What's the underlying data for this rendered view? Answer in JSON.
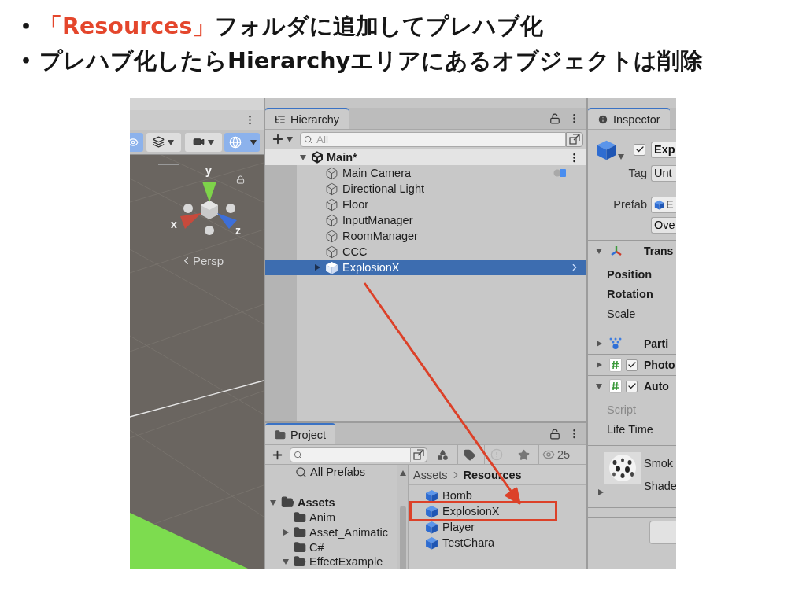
{
  "slide": {
    "bullets": [
      {
        "marker": "•",
        "segments": [
          {
            "text": "「Resources」",
            "emphasis": true
          },
          {
            "text": "フォルダに追加してプレハブ化",
            "emphasis": false
          }
        ]
      },
      {
        "marker": "•",
        "segments": [
          {
            "text": "プレハブ化したらHierarchyエリアにあるオブジェクトは削除",
            "emphasis": false
          }
        ]
      }
    ]
  },
  "scene": {
    "axes": [
      {
        "label": "y"
      },
      {
        "label": "x"
      },
      {
        "label": "z"
      }
    ],
    "projection": "Persp"
  },
  "hierarchy": {
    "tab": {
      "label": "Hierarchy",
      "selected": true
    },
    "search": {
      "placeholder": "All"
    },
    "scene_root": {
      "label": "Main*",
      "expanded": true
    },
    "items": [
      {
        "label": "Main Camera",
        "kind": "object",
        "selected": false,
        "component_icon": true
      },
      {
        "label": "Directional Light",
        "kind": "object",
        "selected": false,
        "component_icon": false
      },
      {
        "label": "Floor",
        "kind": "object",
        "selected": false,
        "component_icon": false
      },
      {
        "label": "InputManager",
        "kind": "object",
        "selected": false,
        "component_icon": false
      },
      {
        "label": "RoomManager",
        "kind": "object",
        "selected": false,
        "component_icon": false
      },
      {
        "label": "CCC",
        "kind": "object",
        "selected": false,
        "component_icon": false
      },
      {
        "label": "ExplosionX",
        "kind": "prefab",
        "expanded": false,
        "selected": true,
        "component_icon": false
      }
    ]
  },
  "project": {
    "tab": {
      "label": "Project",
      "selected": true
    },
    "visible_count": "25",
    "favorites": [
      {
        "label": "All Prefabs"
      }
    ],
    "tree": {
      "label": "Assets",
      "expanded": true,
      "children": [
        {
          "label": "Anim"
        },
        {
          "label": "Asset_Animatic",
          "expanded": false
        },
        {
          "label": "C#"
        },
        {
          "label": "EffectExample",
          "expanded": true
        }
      ]
    },
    "breadcrumb": [
      "Assets",
      "Resources"
    ],
    "assets": [
      {
        "label": "Bomb",
        "highlighted": false
      },
      {
        "label": "ExplosionX",
        "highlighted": true
      },
      {
        "label": "Player",
        "highlighted": false
      },
      {
        "label": "TestChara",
        "highlighted": false
      }
    ]
  },
  "inspector": {
    "tab": {
      "label": "Inspector",
      "selected": true
    },
    "object": {
      "active": true,
      "name": "Exp",
      "tag_label": "Tag",
      "tag": "Unt",
      "prefab_label": "Prefab",
      "prefab": "E",
      "overrides": "Ove"
    },
    "components": [
      {
        "kind": "transform",
        "title": "Trans",
        "expanded": true,
        "properties": [
          {
            "label": "Position",
            "overridden": true,
            "disabled": false
          },
          {
            "label": "Rotation",
            "overridden": true,
            "disabled": false
          },
          {
            "label": "Scale",
            "overridden": false,
            "disabled": false
          }
        ]
      },
      {
        "kind": "particles",
        "title": "Parti",
        "expanded": false
      },
      {
        "kind": "script",
        "title": "Photo",
        "expanded": false,
        "enabled": true
      },
      {
        "kind": "script",
        "title": "Auto",
        "expanded": true,
        "enabled": true,
        "properties": [
          {
            "label": "Script",
            "overridden": false,
            "disabled": true
          },
          {
            "label": "Life Time",
            "overridden": false,
            "disabled": false
          }
        ]
      },
      {
        "kind": "material",
        "title": "Smok",
        "subtitle": "Shade",
        "expanded": false
      }
    ]
  }
}
